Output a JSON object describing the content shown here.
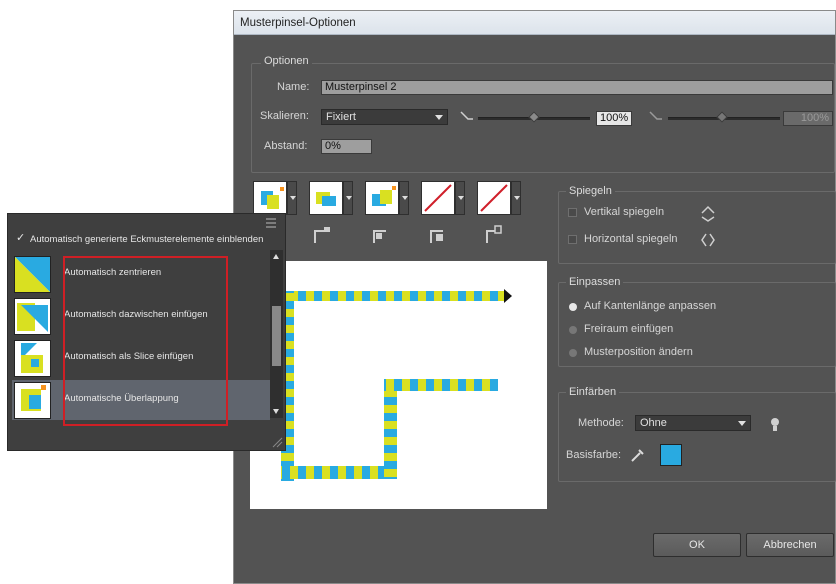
{
  "dialog": {
    "title": "Musterpinsel-Optionen",
    "optionen": {
      "group_title": "Optionen",
      "name_label": "Name:",
      "name_value": "Musterpinsel 2",
      "skalieren_label": "Skalieren:",
      "skalieren_value": "Fixiert",
      "scale_min_value": "100%",
      "scale_max_value": "100%",
      "abstand_label": "Abstand:",
      "abstand_value": "0%"
    },
    "spiegeln": {
      "group_title": "Spiegeln",
      "vertikal_label": "Vertikal spiegeln",
      "horizontal_label": "Horizontal spiegeln"
    },
    "einpassen": {
      "group_title": "Einpassen",
      "options": [
        "Auf Kantenlänge anpassen",
        "Freiraum einfügen",
        "Musterposition ändern"
      ],
      "selected_index": 0
    },
    "einfaerben": {
      "group_title": "Einfärben",
      "methode_label": "Methode:",
      "methode_value": "Ohne",
      "basisfarbe_label": "Basisfarbe:",
      "basisfarbe_color": "#29aae1"
    },
    "buttons": {
      "ok": "OK",
      "cancel": "Abbrechen"
    }
  },
  "flyout": {
    "checkbox_label": "Automatisch generierte Eckmusterelemente einblenden",
    "checkbox_mark": "✓",
    "items": [
      "Automatisch zentrieren",
      "Automatisch dazwischen einfügen",
      "Automatisch als Slice einfügen",
      "Automatische Überlappung"
    ],
    "selected_index": 3
  },
  "colors": {
    "pattern_blue": "#29aae1",
    "pattern_yellow": "#d9e021",
    "highlight_red": "#cf1f25",
    "swatch_orange": "#f7931e"
  }
}
